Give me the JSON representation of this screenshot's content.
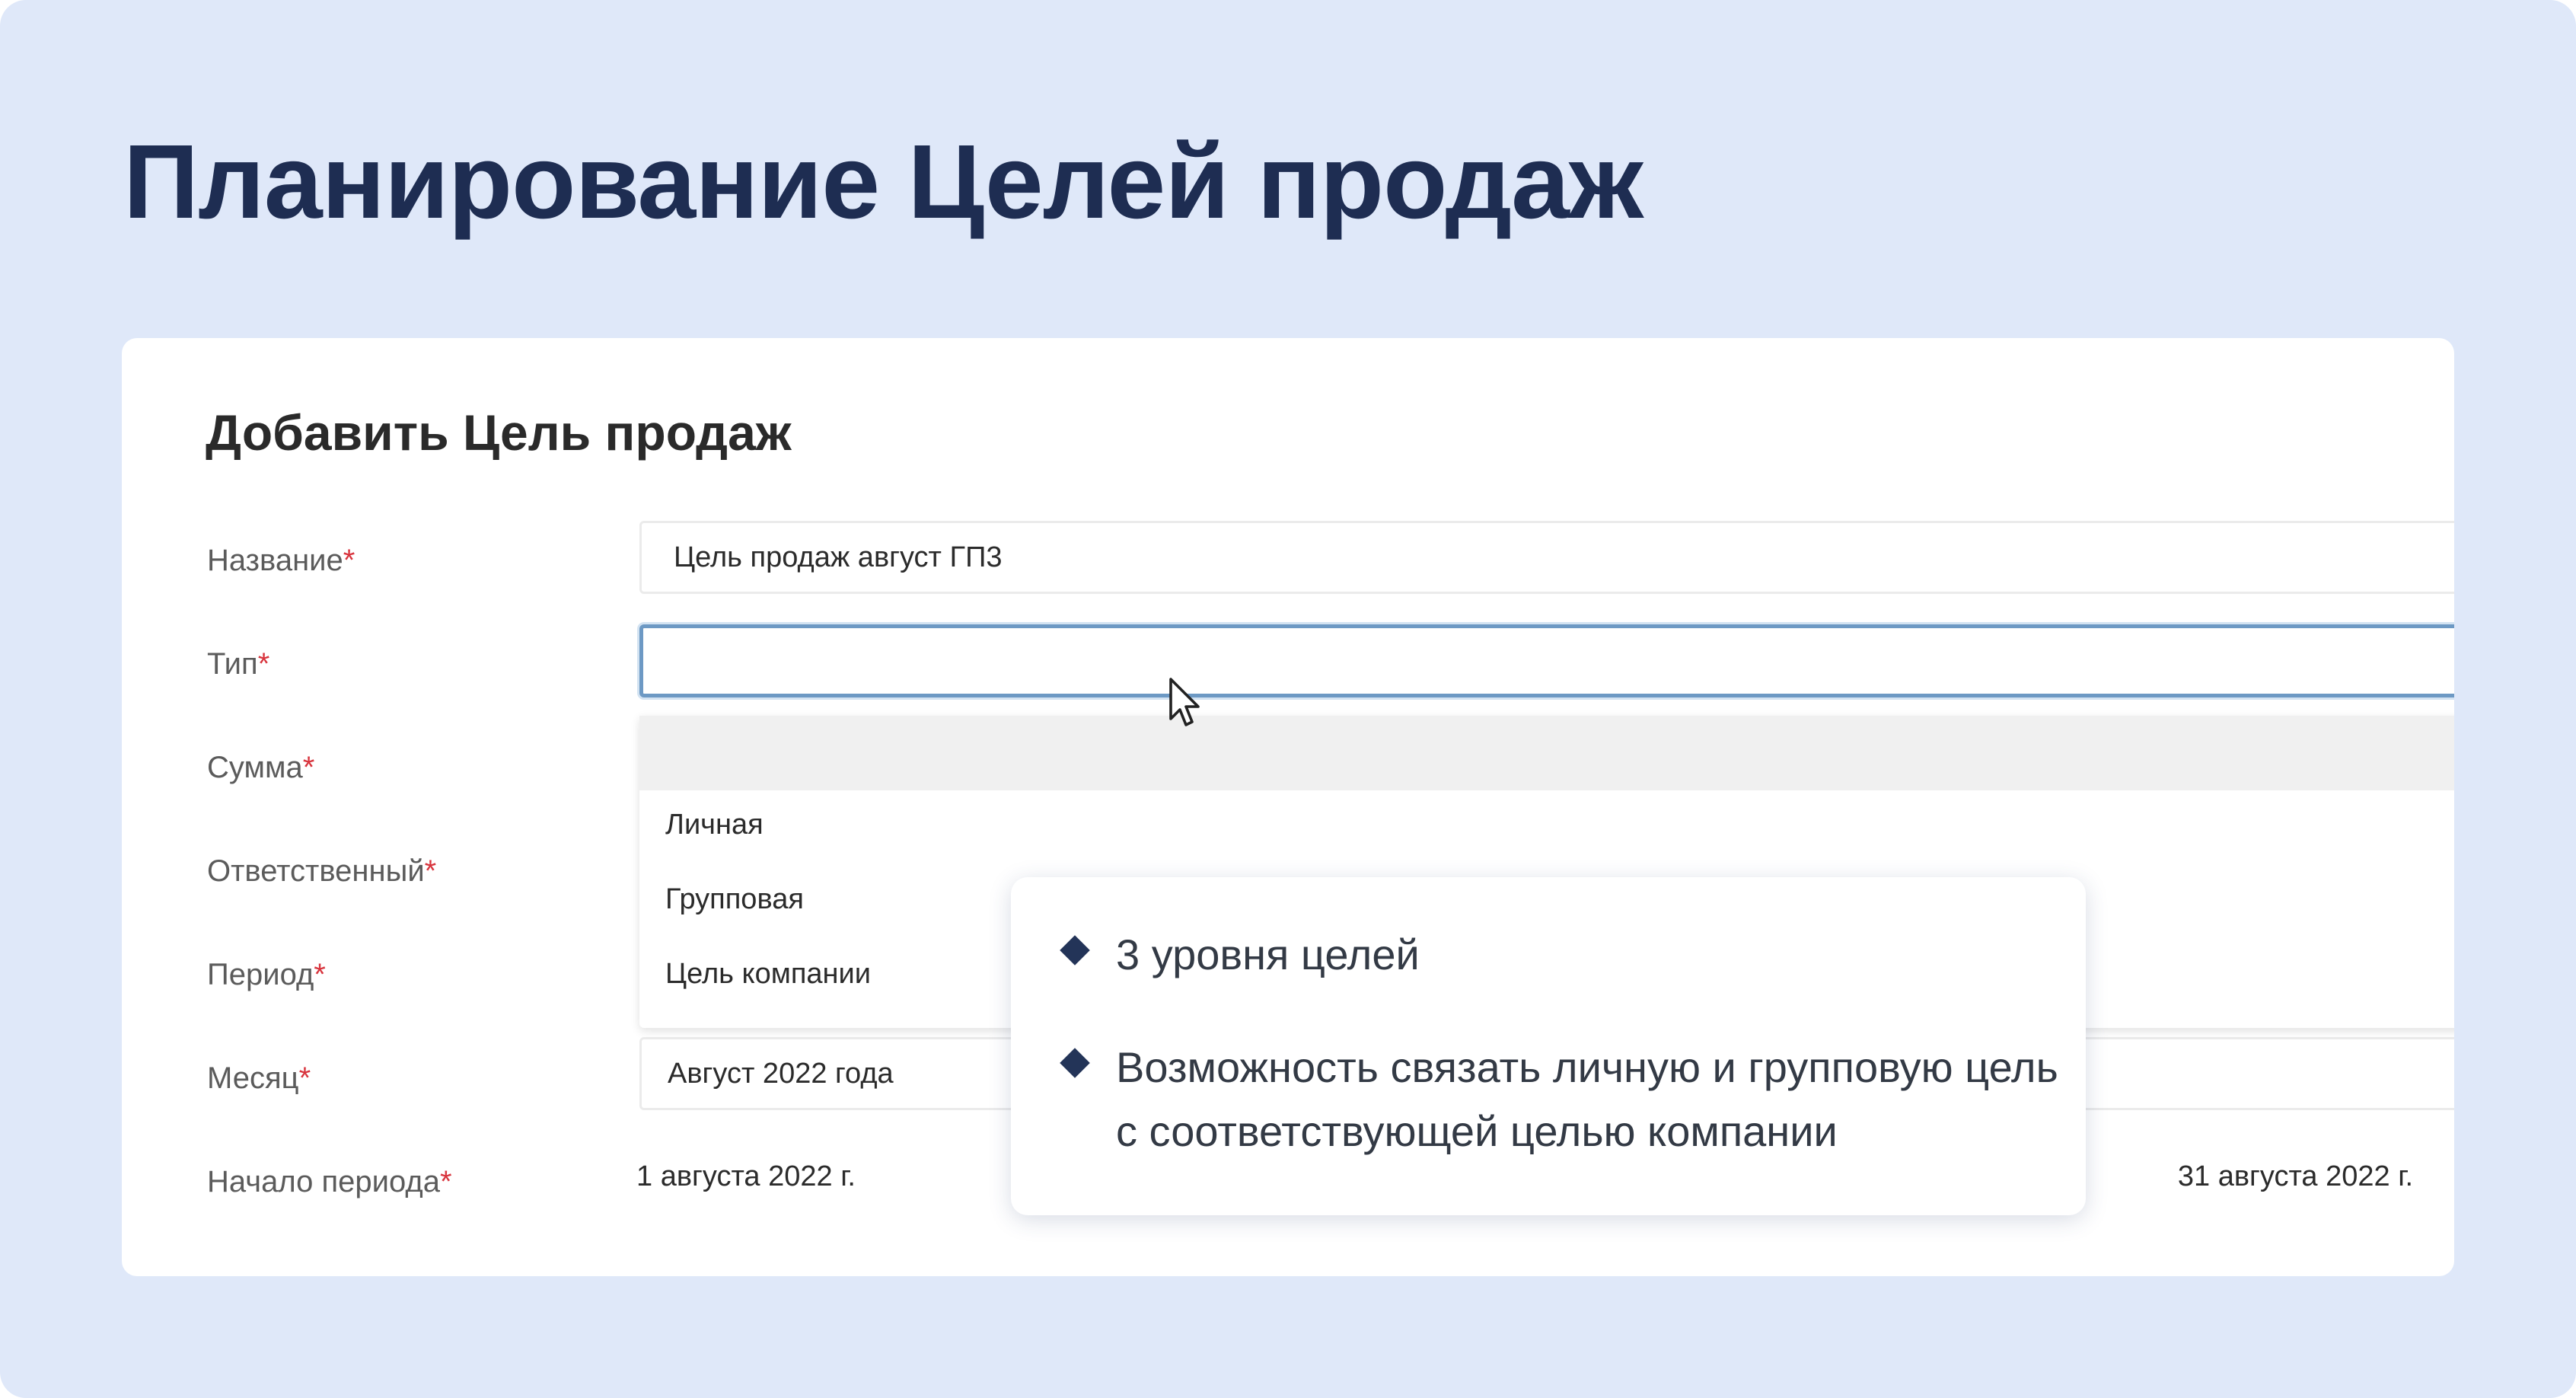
{
  "page": {
    "title": "Планирование Целей продаж"
  },
  "form": {
    "title": "Добавить Цель продаж",
    "required_mark": "*",
    "fields": {
      "name": {
        "label": "Название",
        "value": "Цель продаж август ГП3"
      },
      "type": {
        "label": "Тип",
        "value": ""
      },
      "amount": {
        "label": "Сумма"
      },
      "responsible": {
        "label": "Ответственный"
      },
      "period": {
        "label": "Период"
      },
      "month": {
        "label": "Месяц",
        "value": "Август 2022 года"
      },
      "period_start": {
        "label": "Начало периода",
        "value": "1 августа 2022 г.",
        "end_value": "31 августа 2022 г."
      }
    },
    "type_options": [
      "Личная",
      "Групповая",
      "Цель компании"
    ]
  },
  "callout": {
    "bullets": [
      "3 уровня целей",
      "Возможность связать личную и групповую цель с соответствующей целью компании"
    ]
  },
  "colors": {
    "background": "#dfe8f9",
    "title": "#1e2d52",
    "required": "#d8343d",
    "focus_border": "#6d99c4"
  }
}
